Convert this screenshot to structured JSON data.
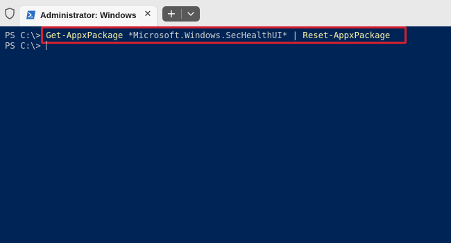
{
  "titlebar": {
    "tab_title": "Administrator: Windows PowerShell",
    "close_glyph": "✕",
    "new_tab_glyph": "+",
    "icons": {
      "shield": "shield-icon",
      "powershell": "powershell-icon",
      "dropdown": "chevron-down-icon"
    }
  },
  "terminal": {
    "prompt1": "PS C:\\> ",
    "cmd_get": "Get-AppxPackage",
    "cmd_arg": " *Microsoft.Windows.SecHealthUI* ",
    "cmd_pipe": "|",
    "cmd_reset": " Reset-AppxPackage",
    "prompt2": "PS C:\\> "
  },
  "colors": {
    "background": "#012456",
    "cmdlet": "#f9f1a5",
    "text": "#cccccc",
    "highlight": "#d2202f"
  }
}
